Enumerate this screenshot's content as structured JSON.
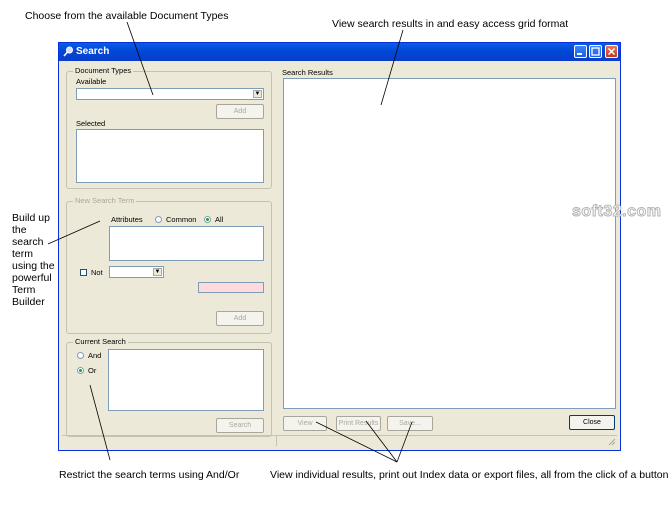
{
  "annotations": {
    "doc_types": "Choose from the available Document Types",
    "search_results": "View search results in and easy access grid format",
    "term_builder": [
      "Build up",
      "the",
      "search",
      "term",
      "using the",
      "powerful",
      "Term",
      "Builder"
    ],
    "restrict": "Restrict the search terms using And/Or",
    "view_results": "View individual results, print out Index data or export files, all from the click of a button"
  },
  "window": {
    "title": "Search",
    "minimize_icon": "minimize-icon",
    "maximize_icon": "maximize-icon",
    "close_icon": "close-icon"
  },
  "document_types": {
    "group_label": "Document Types",
    "available_label": "Available",
    "available_value": "",
    "add_button": "Add",
    "selected_label": "Selected"
  },
  "new_search_term": {
    "group_label": "New Search Term",
    "attributes_label": "Attributes",
    "common_label": "Common",
    "all_label": "All",
    "selected_radio": "All",
    "not_label": "Not",
    "not_checked": false,
    "operator_value": "",
    "add_button": "Add"
  },
  "current_search": {
    "group_label": "Current Search",
    "and_label": "And",
    "or_label": "Or",
    "selected_radio": "Or",
    "search_button": "Search"
  },
  "search_results": {
    "label": "Search Results",
    "view_button": "View",
    "print_button": "Print Results",
    "save_button": "Save...",
    "close_button": "Close"
  },
  "watermark": "soft32.com",
  "colors": {
    "titlebar": "#0a5ce6",
    "window_bg": "#ece9d8",
    "pink_field": "#ffd9dc"
  }
}
